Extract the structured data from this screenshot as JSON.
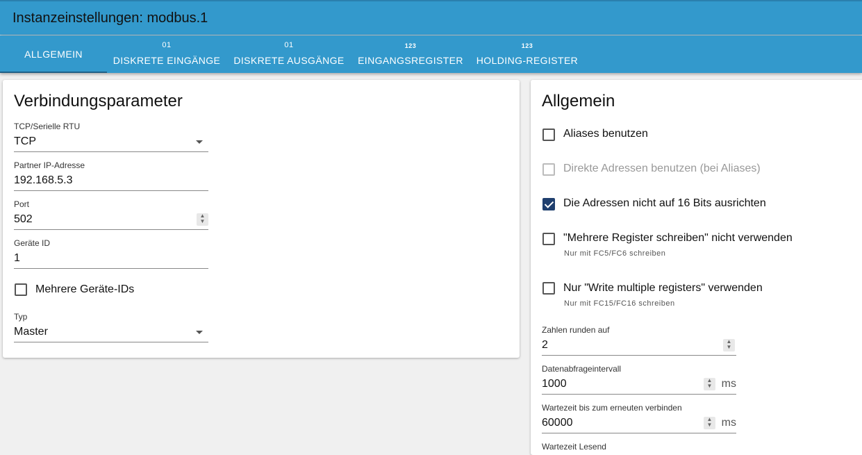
{
  "header": {
    "title": "Instanzeinstellungen: modbus.1"
  },
  "tabs": [
    {
      "icon": "",
      "label": "ALLGEMEIN",
      "active": true
    },
    {
      "icon": "01",
      "label": "DISKRETE EINGÄNGE"
    },
    {
      "icon": "01",
      "label": "DISKRETE AUSGÄNGE"
    },
    {
      "icon": "123",
      "label": "EINGANGSREGISTER"
    },
    {
      "icon": "123",
      "label": "HOLDING-REGISTER"
    }
  ],
  "connection": {
    "title": "Verbindungsparameter",
    "mode": {
      "label": "TCP/Serielle RTU",
      "value": "TCP"
    },
    "ip": {
      "label": "Partner IP-Adresse",
      "value": "192.168.5.3"
    },
    "port": {
      "label": "Port",
      "value": "502"
    },
    "device_id": {
      "label": "Geräte ID",
      "value": "1"
    },
    "multi_ids": {
      "label": "Mehrere Geräte-IDs",
      "checked": false
    },
    "type": {
      "label": "Typ",
      "value": "Master"
    }
  },
  "general": {
    "title": "Allgemein",
    "aliases": {
      "label": "Aliases benutzen",
      "checked": false
    },
    "direct": {
      "label": "Direkte Adressen benutzen (bei Aliases)",
      "checked": false,
      "disabled": true
    },
    "no_align": {
      "label": "Die Adressen nicht auf 16 Bits ausrichten",
      "checked": true
    },
    "no_multi_write": {
      "label": "\"Mehrere Register schreiben\" nicht verwenden",
      "help": "Nur mit FC5/FC6 schreiben",
      "checked": false
    },
    "only_multi_write": {
      "label": "Nur \"Write multiple registers\" verwenden",
      "help": "Nur mit FC15/FC16 schreiben",
      "checked": false
    },
    "round": {
      "label": "Zahlen runden auf",
      "value": "2"
    },
    "poll": {
      "label": "Datenabfrageintervall",
      "value": "1000",
      "unit": "ms"
    },
    "reconnect": {
      "label": "Wartezeit bis zum erneuten verbinden",
      "value": "60000",
      "unit": "ms"
    },
    "read_wait": {
      "label": "Wartezeit Lesend"
    }
  }
}
